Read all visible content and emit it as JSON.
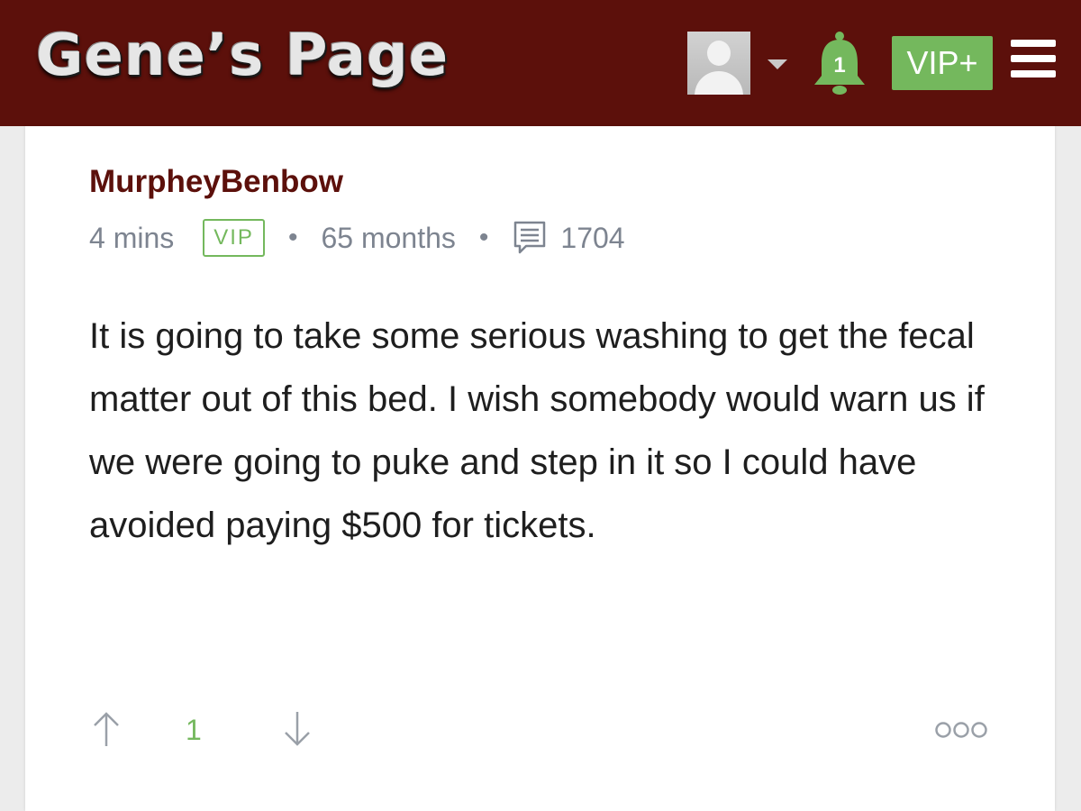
{
  "header": {
    "logo_text": "Gene’s Page",
    "notification_count": "1",
    "vip_button_label": "VIP+",
    "icons": {
      "avatar": "user-avatar-icon",
      "dropdown": "caret-down-icon",
      "notifications": "bell-icon",
      "menu": "hamburger-menu-icon"
    }
  },
  "post": {
    "username": "MurpheyBenbow",
    "time_ago": "4 mins",
    "badge": "VIP",
    "membership": "65 months",
    "comment_count": "1704",
    "body": "It is going to take some serious washing to get the fecal matter out of this bed. I wish somebody would warn us if we were going to puke and step in it so I could have avoided paying $500 for tickets.",
    "votes": "1",
    "icons": {
      "comments": "comment-icon",
      "upvote": "arrow-up-icon",
      "downvote": "arrow-down-icon",
      "more": "more-options-icon"
    }
  },
  "colors": {
    "header_bg": "#5c100b",
    "accent_green": "#74b85d",
    "username": "#5c100b",
    "meta_gray": "#7d8490"
  }
}
